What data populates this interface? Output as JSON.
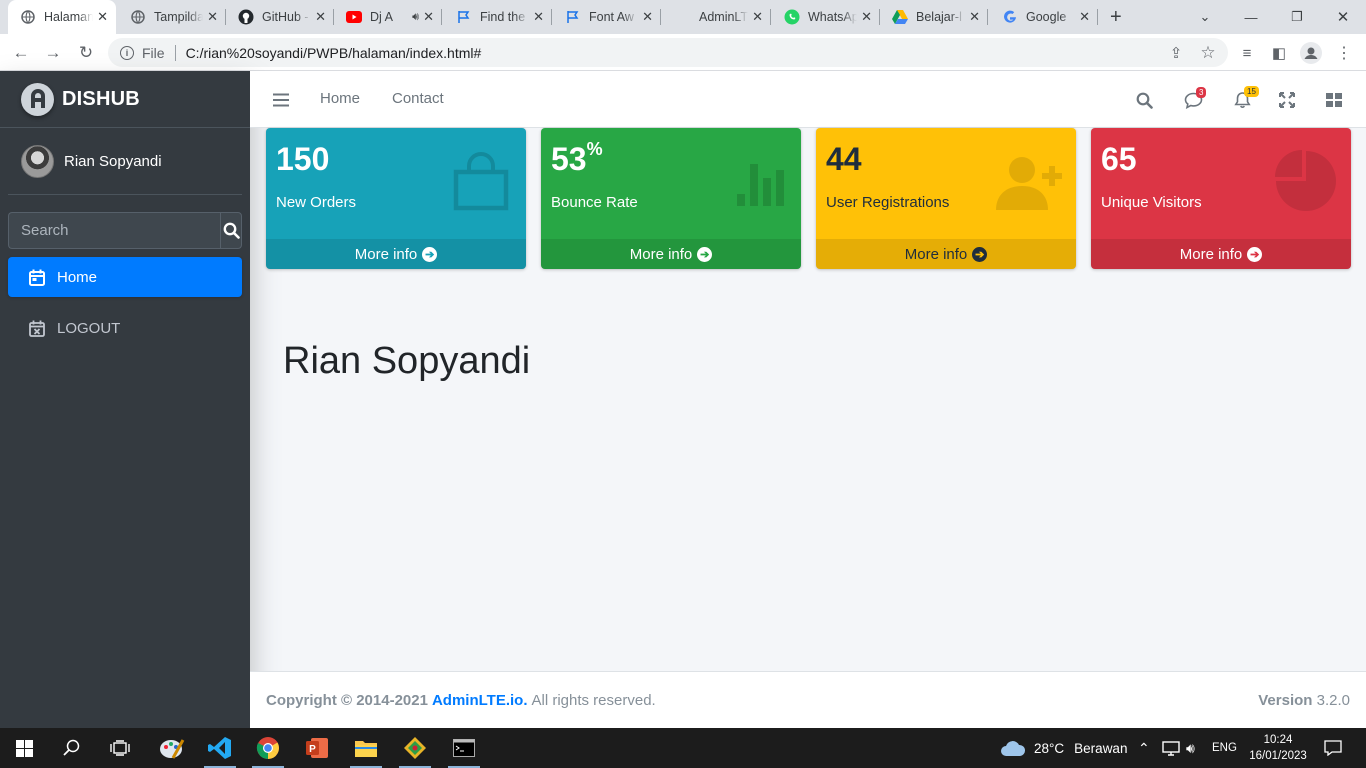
{
  "browser": {
    "tabs": [
      {
        "title": "Halaman",
        "active": true
      },
      {
        "title": "Tampilda"
      },
      {
        "title": "GitHub -"
      },
      {
        "title": "Dj A"
      },
      {
        "title": "Find the"
      },
      {
        "title": "Font Aw"
      },
      {
        "title": "AdminLT"
      },
      {
        "title": "WhatsAp"
      },
      {
        "title": "Belajar-l"
      },
      {
        "title": "Google"
      }
    ],
    "address_scheme": "File",
    "address": "C:/rian%20soyandi/PWPB/halaman/index.html#"
  },
  "sidebar": {
    "brand": "DISHUB",
    "user_name": "Rian Sopyandi",
    "search_placeholder": "Search",
    "nav": [
      {
        "label": "Home",
        "active": true,
        "icon": "calendar-icon"
      },
      {
        "label": "LOGOUT",
        "active": false,
        "icon": "calendar-x-icon"
      }
    ]
  },
  "navbar": {
    "links": [
      "Home",
      "Contact"
    ],
    "messages_badge": "3",
    "notifications_badge": "15"
  },
  "info_boxes": [
    {
      "value": "150",
      "suffix": "",
      "label": "New Orders",
      "more": "More info",
      "color": "#17a2b8",
      "icon": "shopping-bag-icon"
    },
    {
      "value": "53",
      "suffix": "%",
      "label": "Bounce Rate",
      "more": "More info",
      "color": "#28a745",
      "icon": "bar-chart-icon"
    },
    {
      "value": "44",
      "suffix": "",
      "label": "User Registrations",
      "more": "More info",
      "color": "#ffc107",
      "icon": "user-plus-icon"
    },
    {
      "value": "65",
      "suffix": "",
      "label": "Unique Visitors",
      "more": "More info",
      "color": "#dc3545",
      "icon": "pie-chart-icon"
    }
  ],
  "content": {
    "heading": "Rian Sopyandi"
  },
  "footer": {
    "copyright": "Copyright © 2014-2021",
    "link": "AdminLTE.io.",
    "rights": "All rights reserved.",
    "version_label": "Version",
    "version": "3.2.0"
  },
  "taskbar": {
    "weather_temp": "28°C",
    "weather_desc": "Berawan",
    "language": "ENG",
    "time": "10:24",
    "date": "16/01/2023"
  },
  "colors": {
    "primary": "#007bff",
    "sidebar": "#343a40"
  }
}
